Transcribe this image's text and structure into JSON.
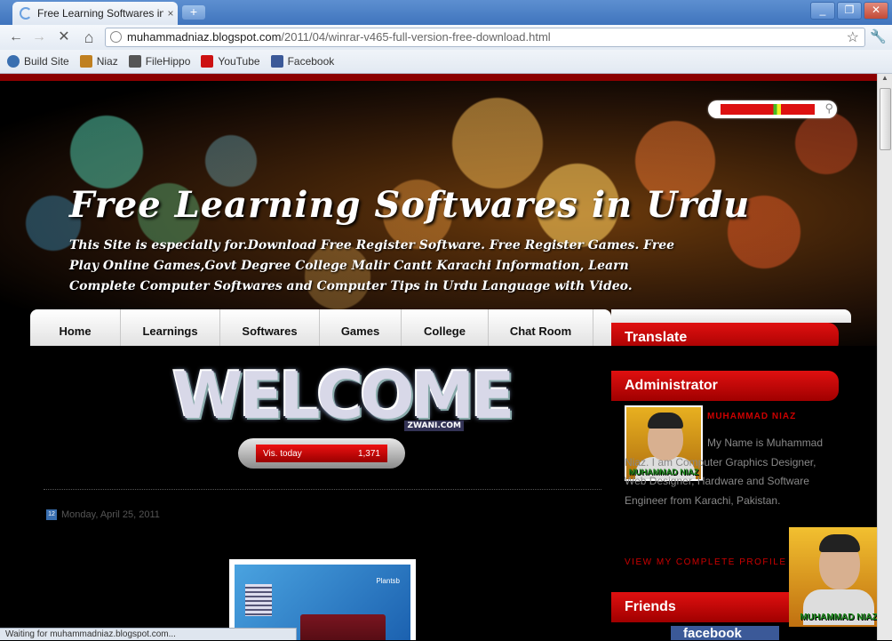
{
  "browser": {
    "tab_title": "Free Learning Softwares in Ur",
    "tab_close": "×",
    "new_tab": "+",
    "url_host": "muhammadniaz.blogspot.com",
    "url_path": "/2011/04/winrar-v465-full-version-free-download.html",
    "window_buttons": [
      "_",
      "❐",
      "✕"
    ],
    "nav_icons": {
      "back": "←",
      "forward": "→",
      "stop": "✕",
      "home": "⌂",
      "star": "☆",
      "wrench": "🔧"
    },
    "bookmarks": [
      {
        "label": "Build Site",
        "icon": "globe-icon",
        "color": "#3a6fb0"
      },
      {
        "label": "Niaz",
        "icon": "avatar-icon",
        "color": "#c08020"
      },
      {
        "label": "FileHippo",
        "icon": "filehippo-icon",
        "color": "#555555"
      },
      {
        "label": "YouTube",
        "icon": "youtube-icon",
        "color": "#cc1111"
      },
      {
        "label": "Facebook",
        "icon": "facebook-icon",
        "color": "#3b5998"
      }
    ],
    "status_text": "Waiting for muhammadniaz.blogspot.com..."
  },
  "header": {
    "title": "Free Learning Softwares in Urdu",
    "description": "This Site is especially for.Download Free Register Software. Free Register Games. Free Play Online Games,Govt Degree College Malir Cantt Karachi Information, Learn Complete Computer Softwares and Computer Tips in Urdu Language with Video."
  },
  "nav": {
    "items": [
      "Home",
      "Learnings",
      "Softwares",
      "Games",
      "College",
      "Chat Room"
    ]
  },
  "sidebar": {
    "translate_title": "Translate",
    "admin_title": "Administrator",
    "admin_name": "MUHAMMAD NIAZ",
    "admin_bio": "My Name is Muhammad Niaz. I am Computer Graphics Designer, Web Designer, Hardware and Software Engineer from Karachi, Pakistan.",
    "profile_link": "VIEW MY COMPLETE PROFILE",
    "friends_title": "Friends",
    "photo_label": "MUHAMMAD NIAZ",
    "facebook_text": "facebook"
  },
  "content": {
    "welcome_text": "WELCOME",
    "welcome_tag": "ZWANI.COM",
    "visits_label": "Vis. today",
    "visits_count": "1,371",
    "post_date": "Monday, April 25, 2011",
    "calendar_day": "12",
    "image_label": "Plantsb"
  },
  "colors": {
    "accent_red": "#cc0000",
    "background": "#000000"
  }
}
